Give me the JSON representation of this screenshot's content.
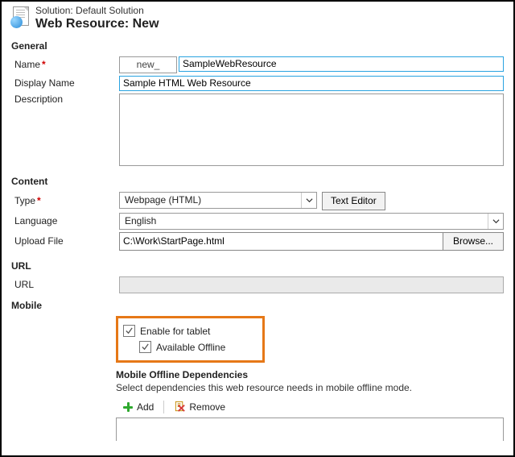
{
  "header": {
    "solution_label": "Solution:",
    "solution_name": "Default Solution",
    "page_title": "Web Resource: New"
  },
  "sections": {
    "general": "General",
    "content": "Content",
    "url": "URL",
    "mobile": "Mobile"
  },
  "general": {
    "name_label": "Name",
    "name_prefix": "new_",
    "name_value": "SampleWebResource",
    "display_name_label": "Display Name",
    "display_name_value": "Sample HTML Web Resource",
    "description_label": "Description",
    "description_value": ""
  },
  "content": {
    "type_label": "Type",
    "type_value": "Webpage (HTML)",
    "text_editor_btn": "Text Editor",
    "language_label": "Language",
    "language_value": "English",
    "upload_label": "Upload File",
    "upload_value": "C:\\Work\\StartPage.html",
    "browse_btn": "Browse..."
  },
  "url": {
    "label": "URL",
    "value": ""
  },
  "mobile": {
    "enable_tablet_label": "Enable for tablet",
    "enable_tablet_checked": true,
    "available_offline_label": "Available Offline",
    "available_offline_checked": true,
    "dependencies_header": "Mobile Offline Dependencies",
    "dependencies_desc": "Select dependencies this web resource needs in mobile offline mode.",
    "add_btn": "Add",
    "remove_btn": "Remove"
  }
}
